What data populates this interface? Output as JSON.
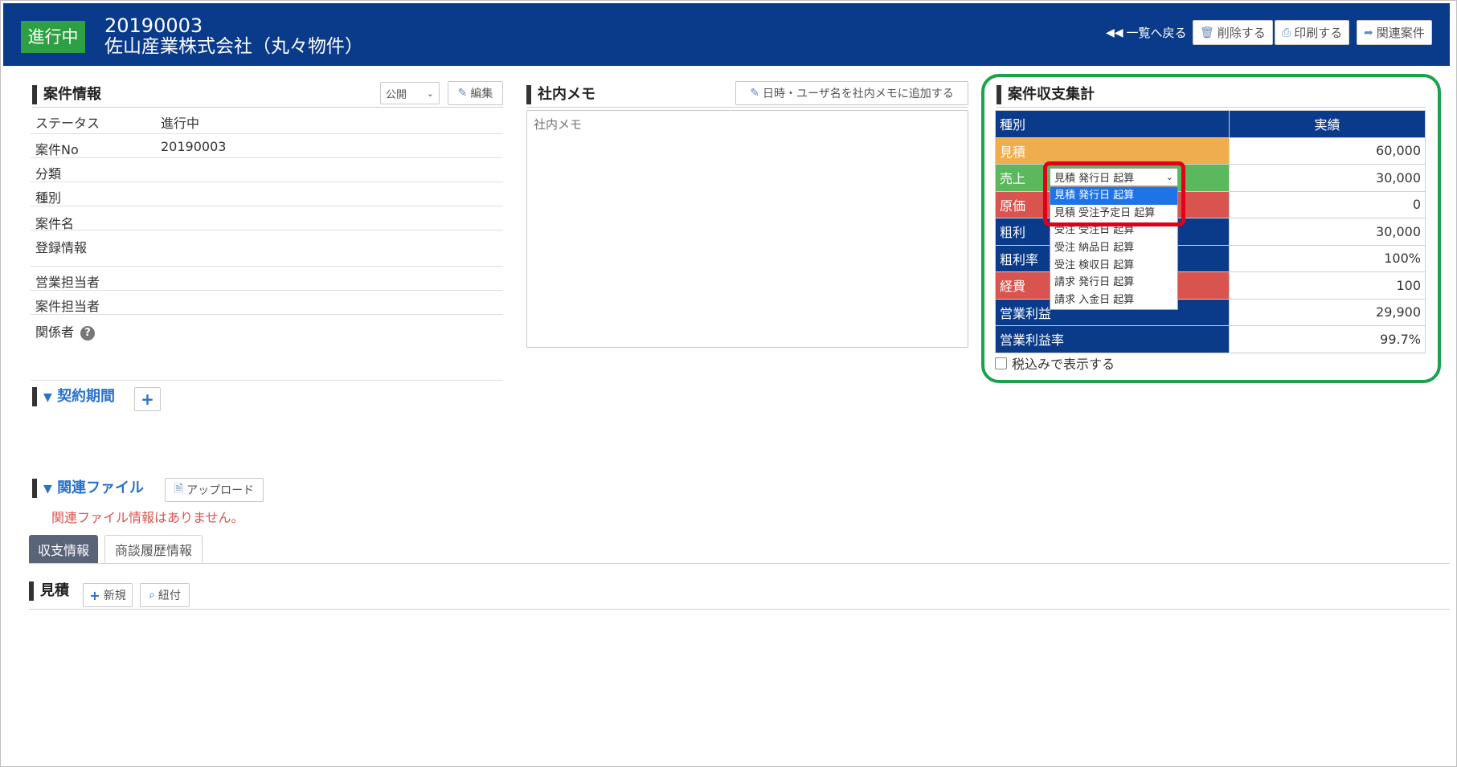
{
  "header": {
    "status": "進行中",
    "case_no": "20190003",
    "title": "佐山産業株式会社（丸々物件）",
    "back_label": "一覧へ戻る",
    "delete_label": "削除する",
    "print_label": "印刷する",
    "related_label": "関連案件"
  },
  "case_info": {
    "title": "案件情報",
    "visibility": "公開",
    "edit_label": "編集",
    "rows": [
      {
        "key": "ステータス",
        "value": "進行中"
      },
      {
        "key": "案件No",
        "value": "20190003"
      },
      {
        "key": "分類",
        "value": ""
      },
      {
        "key": "種別",
        "value": ""
      },
      {
        "key": "案件名",
        "value": ""
      },
      {
        "key": "登録情報",
        "value": ""
      },
      {
        "key": "営業担当者",
        "value": ""
      },
      {
        "key": "案件担当者",
        "value": ""
      },
      {
        "key": "関係者",
        "value": ""
      }
    ]
  },
  "memo": {
    "title": "社内メモ",
    "add_stamp_label": "日時・ユーザ名を社内メモに追加する",
    "placeholder": "社内メモ"
  },
  "summary": {
    "title": "案件収支集計",
    "col_type": "種別",
    "col_actual": "実績",
    "rows": [
      {
        "label": "見積",
        "value": "60,000",
        "color": "#f0ad4e"
      },
      {
        "label": "売上",
        "value": "30,000",
        "color": "#5cb85c"
      },
      {
        "label": "原価",
        "value": "0",
        "color": "#d9534f"
      },
      {
        "label": "粗利",
        "value": "30,000",
        "color": "#0a3a8a"
      },
      {
        "label": "粗利率",
        "value": "100%",
        "color": "#0a3a8a"
      },
      {
        "label": "経費",
        "value": "100",
        "color": "#d9534f"
      },
      {
        "label": "営業利益",
        "value": "29,900",
        "color": "#0a3a8a"
      },
      {
        "label": "営業利益率",
        "value": "99.7%",
        "color": "#0a3a8a"
      }
    ],
    "tax_checkbox_label": "税込みで表示する",
    "dropdown": {
      "selected": "見積 発行日 起算",
      "options": [
        "見積 発行日 起算",
        "見積 受注予定日 起算",
        "受注 受注日 起算",
        "受注 納品日 起算",
        "受注 検収日 起算",
        "請求 発行日 起算",
        "請求 入金日 起算"
      ]
    }
  },
  "contract": {
    "title": "契約期間"
  },
  "files": {
    "title": "関連ファイル",
    "upload_label": "アップロード",
    "empty_message": "関連ファイル情報はありません。"
  },
  "tabs": [
    {
      "label": "収支情報"
    },
    {
      "label": "商談履歴情報"
    }
  ],
  "estimate": {
    "title": "見積",
    "new_label": "新規",
    "link_label": "紐付"
  }
}
